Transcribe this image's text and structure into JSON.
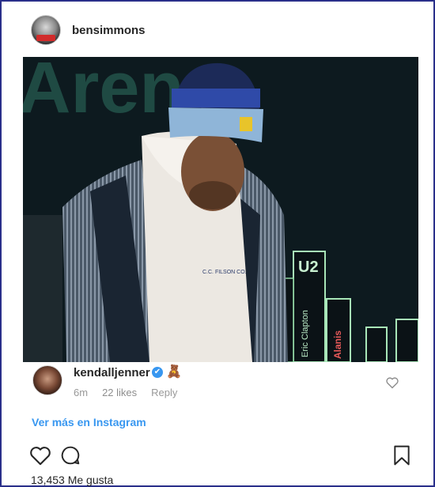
{
  "post": {
    "author": "bensimmons",
    "image_text": {
      "arena_sign": "Areno",
      "sweater_text": "C.C. FILSON CO.",
      "poster_u2": "U2",
      "poster_clapton": "Eric Clapton",
      "poster_alanis": "Alanis"
    }
  },
  "comment": {
    "author": "kendalljenner",
    "verified_glyph": "✔",
    "emoji": "🧸",
    "time": "6m",
    "likes": "22 likes",
    "reply_label": "Reply"
  },
  "link": {
    "label": "Ver más en Instagram"
  },
  "footer": {
    "likes_count": "13,453 Me gusta",
    "icons": [
      "heart-icon",
      "comment-icon",
      "bookmark-icon"
    ]
  },
  "colors": {
    "link_blue": "#3897f0",
    "frame_border": "#2a2f8a",
    "text_dark": "#262626",
    "text_muted": "#999999"
  }
}
